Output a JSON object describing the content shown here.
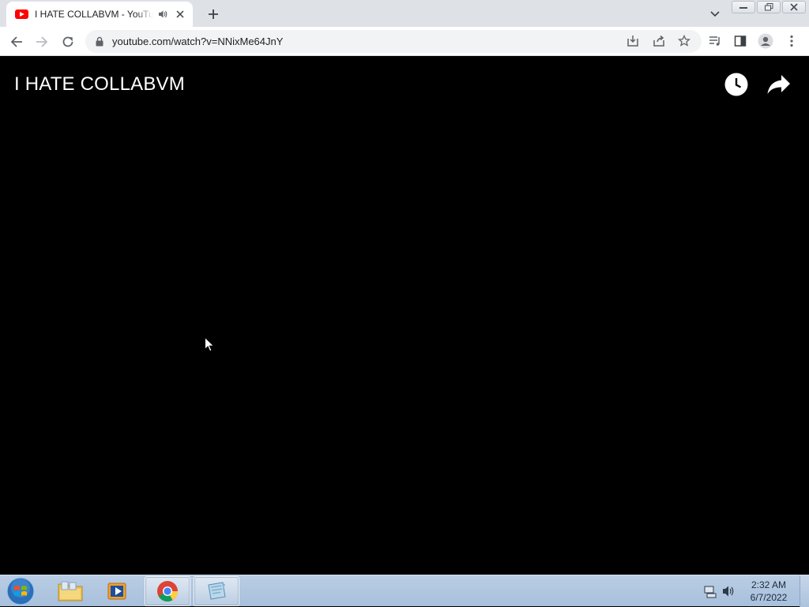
{
  "browser": {
    "tab": {
      "title": "I HATE COLLABVM - YouTube"
    },
    "address": {
      "url": "youtube.com/watch?v=NNixMe64JnY"
    }
  },
  "video": {
    "title": "I HATE COLLABVM",
    "actions": [
      "watch-later-icon",
      "share-icon"
    ]
  },
  "taskbar": {
    "apps": [
      "windows-explorer",
      "windows-media-player",
      "google-chrome",
      "control-panel"
    ],
    "active_app": "google-chrome",
    "clock": {
      "time": "2:32 AM",
      "date": "6/7/2022"
    }
  },
  "colors": {
    "youtube_red": "#ff0000",
    "video_bg": "#000000",
    "tabstrip_bg": "#dee1e6"
  }
}
